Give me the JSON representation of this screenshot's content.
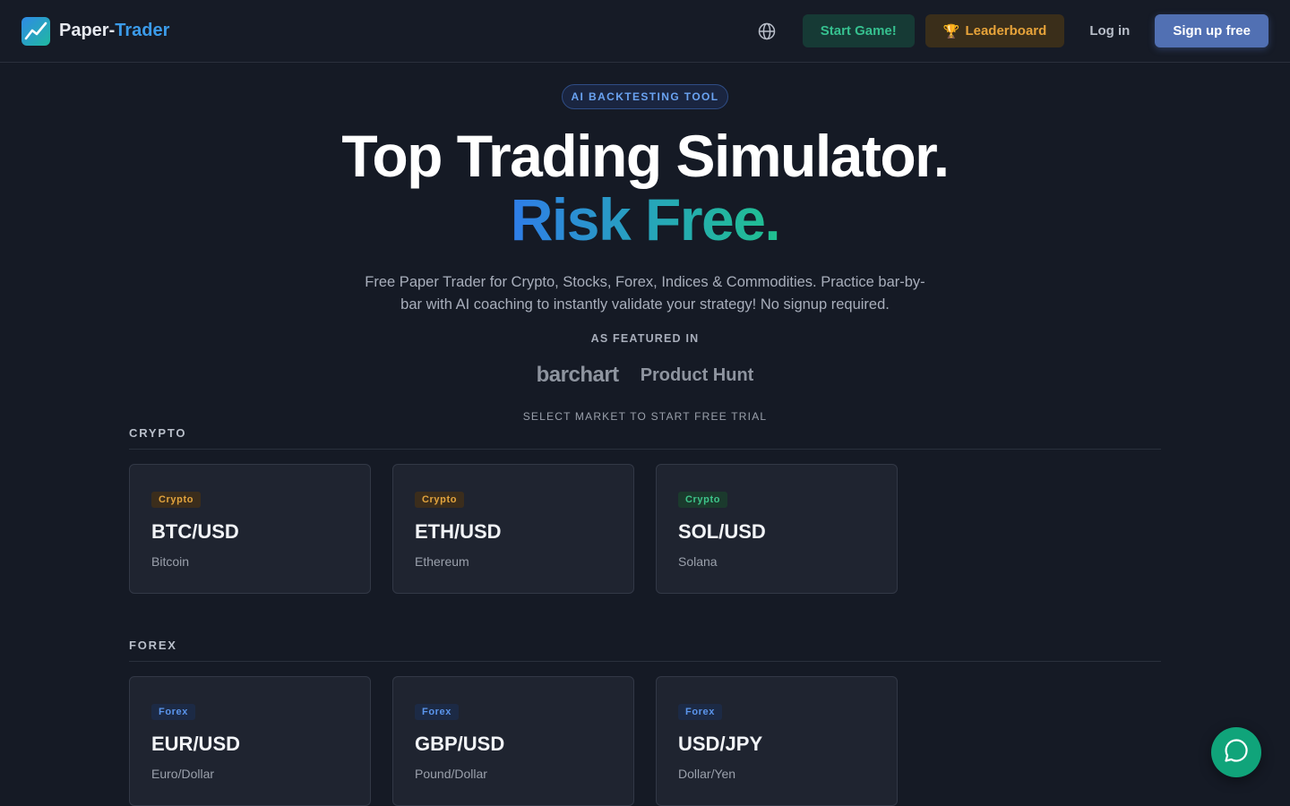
{
  "header": {
    "logo_prefix": "Paper-",
    "logo_suffix": "Trader",
    "start_game_label": "Start Game!",
    "leaderboard_label": "Leaderboard",
    "leaderboard_icon": "🏆",
    "login_label": "Log in",
    "signup_label": "Sign up free"
  },
  "hero": {
    "badge": "AI BACKTESTING TOOL",
    "title_line1": "Top Trading Simulator.",
    "title_line2": "Risk Free.",
    "subtitle": "Free Paper Trader for Crypto, Stocks, Forex, Indices & Commodities. Practice bar-by-bar with AI coaching to instantly validate your strategy! No signup required.",
    "featured_label": "AS FEATURED IN",
    "press": [
      "barchart",
      "Product Hunt"
    ],
    "select_label": "SELECT MARKET TO START FREE TRIAL"
  },
  "sections": {
    "crypto": {
      "title": "CRYPTO",
      "cards": [
        {
          "tag": "Crypto",
          "pair": "BTC/USD",
          "name": "Bitcoin"
        },
        {
          "tag": "Crypto",
          "pair": "ETH/USD",
          "name": "Ethereum"
        },
        {
          "tag": "Crypto",
          "pair": "SOL/USD",
          "name": "Solana"
        }
      ]
    },
    "forex": {
      "title": "FOREX",
      "cards": [
        {
          "tag": "Forex",
          "pair": "EUR/USD",
          "name": "Euro/Dollar"
        },
        {
          "tag": "Forex",
          "pair": "GBP/USD",
          "name": "Pound/Dollar"
        },
        {
          "tag": "Forex",
          "pair": "USD/JPY",
          "name": "Dollar/Yen"
        }
      ]
    }
  },
  "colors": {
    "background": "#151a25",
    "accent_blue": "#3b9be9",
    "accent_green": "#36c08f",
    "accent_orange": "#e7a33a",
    "signup_button": "#5170b3"
  },
  "icons": {
    "logo": "chart-line-icon",
    "language": "globe-icon",
    "chat": "chat-bubble-icon"
  }
}
